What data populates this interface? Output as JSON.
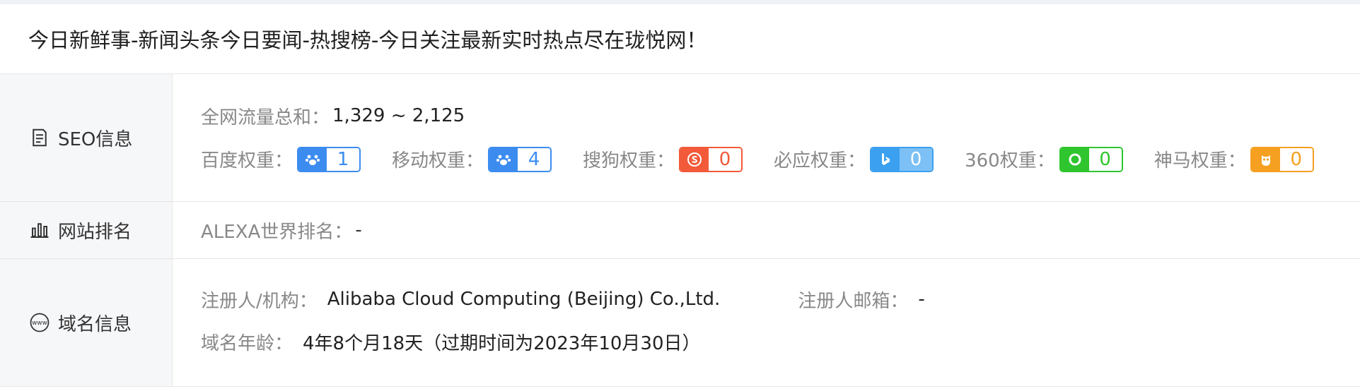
{
  "page_title": "今日新鲜事-新闻头条今日要闻-热搜榜-今日关注最新实时热点尽在珑悦网！",
  "seo": {
    "label": "SEO信息",
    "traffic_label": "全网流量总和：",
    "traffic_value": "1,329 ~ 2,125",
    "weights": [
      {
        "label": "百度权重：",
        "value": "1",
        "icon": "baidu-paw-icon",
        "color": "#3c8cf0"
      },
      {
        "label": "移动权重：",
        "value": "4",
        "icon": "baidu-paw-icon",
        "color": "#3c8cf0"
      },
      {
        "label": "搜狗权重：",
        "value": "0",
        "icon": "sogou-s-icon",
        "color": "#f25a3a"
      },
      {
        "label": "必应权重：",
        "value": "0",
        "icon": "bing-b-icon",
        "color": "#3ca0f0"
      },
      {
        "label": "360权重：",
        "value": "0",
        "icon": "360-circle-icon",
        "color": "#2ec52e"
      },
      {
        "label": "神马权重：",
        "value": "0",
        "icon": "shenma-owl-icon",
        "color": "#f5a021"
      }
    ]
  },
  "ranking": {
    "label": "网站排名",
    "alexa_label": "ALEXA世界排名：",
    "alexa_value": "-"
  },
  "domain": {
    "label": "域名信息",
    "registrant_label": "注册人/机构：",
    "registrant_value": "Alibaba Cloud Computing (Beijing) Co.,Ltd.",
    "email_label": "注册人邮箱：",
    "email_value": "-",
    "age_label": "域名年龄：",
    "age_value": "4年8个月18天（过期时间为2023年10月30日）"
  }
}
